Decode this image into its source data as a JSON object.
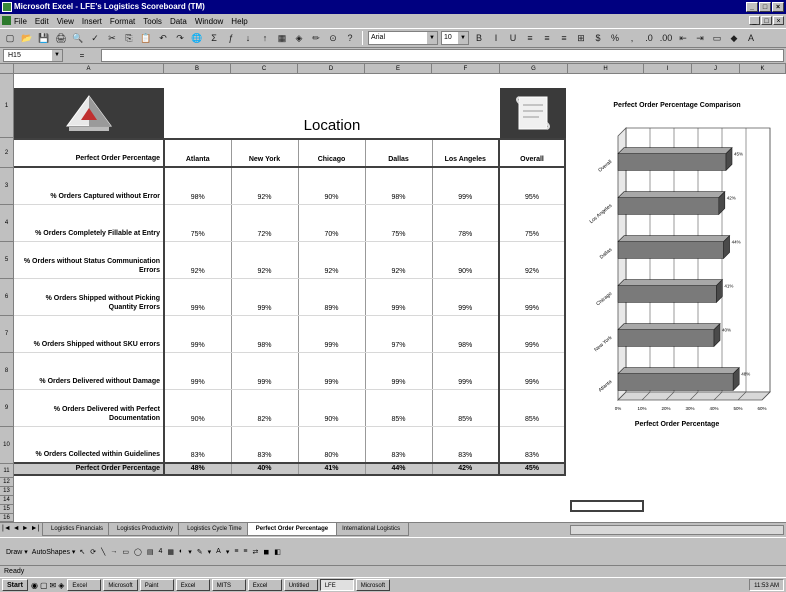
{
  "window": {
    "title": "Microsoft Excel - LFE's Logistics Scoreboard (TM)",
    "controls": [
      "_",
      "□",
      "×"
    ]
  },
  "menu": [
    "File",
    "Edit",
    "View",
    "Insert",
    "Format",
    "Tools",
    "Data",
    "Window",
    "Help"
  ],
  "toolbar": {
    "font": "Arial",
    "size": "10",
    "buttons_left": [
      "new-icon",
      "open-icon",
      "save-icon",
      "print-icon",
      "preview-icon",
      "spell-icon",
      "cut-icon",
      "copy-icon",
      "paste-icon",
      "undo-icon",
      "redo-icon",
      "hyperlink-icon",
      "autosum-icon",
      "function-icon",
      "sort-asc-icon",
      "sort-desc-icon",
      "chart-wizard-icon",
      "map-icon",
      "drawing-icon",
      "zoom-icon",
      "help-icon"
    ],
    "glyphs_left": [
      "▢",
      "📂",
      "💾",
      "🖨",
      "🔍",
      "✓",
      "✂",
      "⎘",
      "📋",
      "↶",
      "↷",
      "🌐",
      "Σ",
      "ƒ",
      "↓",
      "↑",
      "▦",
      "◈",
      "✏",
      "⊙",
      "?"
    ],
    "glyphs_right": [
      "B",
      "I",
      "U",
      "≡",
      "≡",
      "≡",
      "⊞",
      "$",
      "%",
      ",",
      ".0",
      ".00",
      "⇤",
      "⇥",
      "▭",
      "◆",
      "A"
    ]
  },
  "formula_bar": {
    "name_box": "H15",
    "fx": "=",
    "content": ""
  },
  "columns": [
    "A",
    "B",
    "C",
    "D",
    "E",
    "F",
    "G",
    "H",
    "I",
    "J",
    "K"
  ],
  "rows": [
    "1",
    "2",
    "3",
    "4",
    "5",
    "6",
    "7",
    "8",
    "9",
    "10",
    "11",
    "12",
    "13",
    "14",
    "15",
    "16"
  ],
  "sheet": {
    "title": "Location",
    "header_label": "Perfect Order Percentage",
    "locations": [
      "Atlanta",
      "New York",
      "Chicago",
      "Dallas",
      "Los Angeles"
    ],
    "overall_header": "Overall",
    "metrics": [
      {
        "label": "% Orders Captured without Error",
        "values": [
          "98%",
          "92%",
          "90%",
          "98%",
          "99%"
        ],
        "overall": "95%"
      },
      {
        "label": "% Orders Completely Fillable at Entry",
        "values": [
          "75%",
          "72%",
          "70%",
          "75%",
          "78%"
        ],
        "overall": "75%"
      },
      {
        "label": "% Orders without Status Communication Errors",
        "values": [
          "92%",
          "92%",
          "92%",
          "92%",
          "90%"
        ],
        "overall": "92%"
      },
      {
        "label": "% Orders Shipped without Picking Quantity Errors",
        "values": [
          "99%",
          "99%",
          "89%",
          "99%",
          "99%"
        ],
        "overall": "99%"
      },
      {
        "label": "% Orders Shipped without SKU errors",
        "values": [
          "99%",
          "98%",
          "99%",
          "97%",
          "98%"
        ],
        "overall": "99%"
      },
      {
        "label": "% Orders Delivered without Damage",
        "values": [
          "99%",
          "99%",
          "99%",
          "99%",
          "99%"
        ],
        "overall": "99%"
      },
      {
        "label": "% Orders Delivered with Perfect Documentation",
        "values": [
          "90%",
          "82%",
          "90%",
          "85%",
          "85%"
        ],
        "overall": "85%"
      },
      {
        "label": "% Orders Collected within Guidelines",
        "values": [
          "83%",
          "83%",
          "80%",
          "83%",
          "83%"
        ],
        "overall": "83%"
      }
    ],
    "total": {
      "label": "Perfect Order Percentage",
      "values": [
        "48%",
        "40%",
        "41%",
        "44%",
        "42%"
      ],
      "overall": "45%"
    }
  },
  "chart_data": {
    "type": "bar",
    "orientation": "horizontal",
    "title": "Perfect Order Percentage Comparison",
    "xlabel": "Perfect Order Percentage",
    "ylabel": "",
    "categories": [
      "Overall",
      "Los Angeles",
      "Dallas",
      "Chicago",
      "New York",
      "Atlanta"
    ],
    "values": [
      45,
      42,
      44,
      41,
      40,
      48
    ],
    "xlim": [
      0,
      60
    ],
    "x_ticks": [
      "0%",
      "10%",
      "20%",
      "30%",
      "40%",
      "50%",
      "60%"
    ],
    "bar_labels": [
      "45%",
      "42%",
      "44%",
      "41%",
      "40%",
      "48%"
    ],
    "grid": true,
    "bar_color": "#7a7a7a"
  },
  "tabs": {
    "nav": [
      "|◄",
      "◄",
      "►",
      "►|"
    ],
    "items": [
      "Logistics Financials",
      "Logistics Productivity",
      "Logistics Cycle Time",
      "Perfect Order Percentage",
      "International Logistics"
    ],
    "active_index": 3
  },
  "drawing_toolbar": {
    "draw": "Draw ▾",
    "autoshapes": "AutoShapes ▾",
    "glyphs": [
      "↖",
      "⟳",
      "╲",
      "→",
      "▭",
      "◯",
      "▤",
      "4",
      "▦",
      "◐",
      "▾",
      "✎",
      "▾",
      "A",
      "▾",
      "≡",
      "≡",
      "⇄",
      "◼",
      "◧"
    ]
  },
  "status": {
    "text": "Ready"
  },
  "taskbar": {
    "start": "Start",
    "quick_glyphs": [
      "◉",
      "▢",
      "✉",
      "◈"
    ],
    "items": [
      "Excel",
      "Microsoft",
      "Paint",
      "Excel",
      "MITS",
      "Excel",
      "Untitled",
      "LFE",
      "Microsoft"
    ],
    "active_index": 7,
    "clock": "11:53 AM"
  }
}
